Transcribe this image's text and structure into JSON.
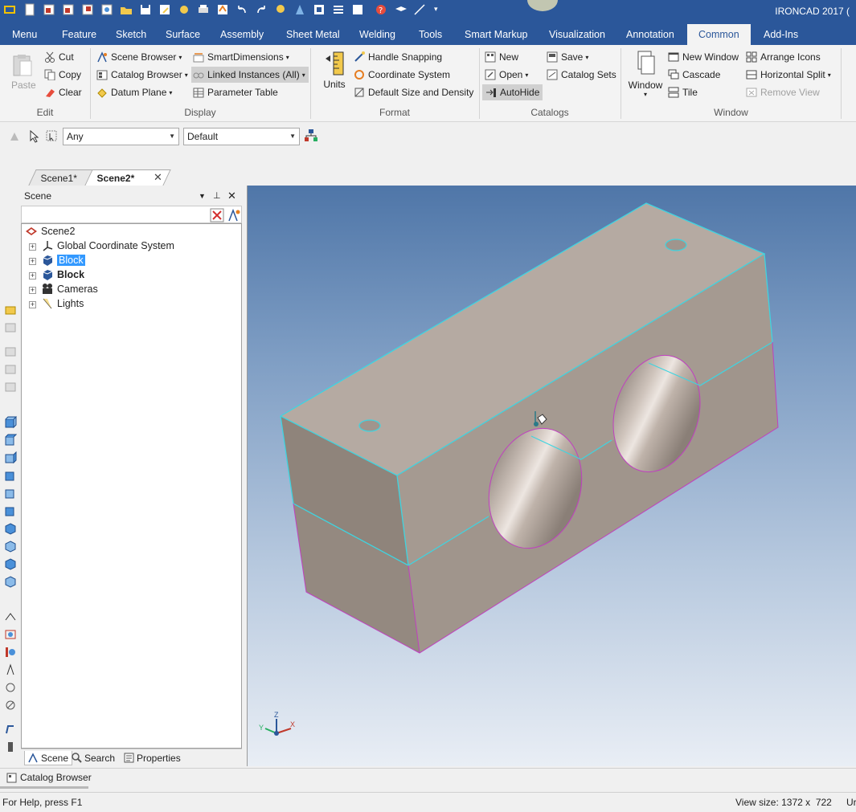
{
  "app": {
    "title": "IRONCAD 2017 ("
  },
  "ribbon_tabs": [
    {
      "label": "Menu"
    },
    {
      "label": "Feature"
    },
    {
      "label": "Sketch"
    },
    {
      "label": "Surface"
    },
    {
      "label": "Assembly"
    },
    {
      "label": "Sheet Metal"
    },
    {
      "label": "Welding"
    },
    {
      "label": "Tools"
    },
    {
      "label": "Smart Markup"
    },
    {
      "label": "Visualization"
    },
    {
      "label": "Annotation"
    },
    {
      "label": "Common"
    },
    {
      "label": "Add-Ins"
    }
  ],
  "ribbon": {
    "edit": {
      "paste": "Paste",
      "cut": "Cut",
      "copy": "Copy",
      "clear": "Clear",
      "group": "Edit"
    },
    "display": {
      "scene_browser": "Scene Browser",
      "catalog_browser": "Catalog Browser",
      "datum_plane": "Datum Plane",
      "smart_dimensions": "SmartDimensions",
      "linked_instances": "Linked Instances (All)",
      "parameter_table": "Parameter Table",
      "group": "Display"
    },
    "format": {
      "units": "Units",
      "handle_snapping": "Handle Snapping",
      "coordinate_system": "Coordinate System",
      "default_size": "Default Size and Density",
      "group": "Format"
    },
    "catalogs": {
      "new": "New",
      "open": "Open",
      "autohide": "AutoHide",
      "save": "Save",
      "catalog_sets": "Catalog Sets",
      "group": "Catalogs"
    },
    "window": {
      "window": "Window",
      "new_window": "New Window",
      "cascade": "Cascade",
      "tile": "Tile",
      "arrange_icons": "Arrange Icons",
      "horizontal_split": "Horizontal Split",
      "remove_view": "Remove View",
      "group": "Window"
    }
  },
  "selection_toolbar": {
    "filter": "Any",
    "mode": "Default"
  },
  "doc_tabs": [
    {
      "label": "Scene1*"
    },
    {
      "label": "Scene2*"
    }
  ],
  "scene_panel": {
    "title": "Scene",
    "tree": [
      {
        "label": "Scene2"
      },
      {
        "label": "Global Coordinate System"
      },
      {
        "label": "Block"
      },
      {
        "label": "Block"
      },
      {
        "label": "Cameras"
      },
      {
        "label": "Lights"
      }
    ],
    "bottom_tabs": [
      {
        "label": "Scene"
      },
      {
        "label": "Search"
      },
      {
        "label": "Properties"
      }
    ]
  },
  "triad": {
    "x": "X",
    "y": "Y",
    "z": "Z"
  },
  "catalog_bar": {
    "label": "Catalog Browser"
  },
  "status": {
    "help": "For Help, press F1",
    "view_size": "View size: 1372 x  722",
    "extra": "Ur"
  },
  "colors": {
    "accent": "#2b579a",
    "selection": "#3399ff",
    "edge_highlight": "#3fd4e0",
    "edge_magenta": "#c040c0"
  }
}
